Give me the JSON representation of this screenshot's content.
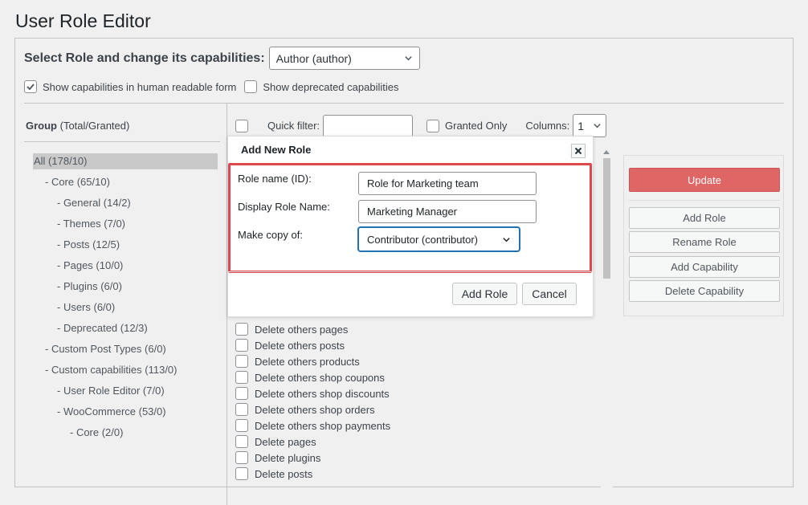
{
  "page": {
    "title": "User Role Editor"
  },
  "role_selector": {
    "label": "Select Role and change its capabilities:",
    "value": "Author (author)"
  },
  "options": {
    "human_readable": {
      "label": "Show capabilities in human readable form",
      "checked": true
    },
    "deprecated": {
      "label": "Show deprecated capabilities",
      "checked": false
    }
  },
  "group": {
    "heading": "Group",
    "heading_sub": "(Total/Granted)",
    "items": [
      "All (178/10)",
      "- Core (65/10)",
      "- General (14/2)",
      "- Themes (7/0)",
      "- Posts (12/5)",
      "- Pages (10/0)",
      "- Plugins (6/0)",
      "- Users (6/0)",
      "- Deprecated (12/3)",
      "- Custom Post Types (6/0)",
      "- Custom capabilities (113/0)",
      "- User Role Editor (7/0)",
      "- WooCommerce (53/0)",
      "- Core (2/0)"
    ]
  },
  "filter": {
    "quick_filter_label": "Quick filter:",
    "granted_only_label": "Granted Only",
    "columns_label": "Columns:",
    "columns_value": "1"
  },
  "capabilities": [
    "Delete others pages",
    "Delete others posts",
    "Delete others products",
    "Delete others shop coupons",
    "Delete others shop discounts",
    "Delete others shop orders",
    "Delete others shop payments",
    "Delete pages",
    "Delete plugins",
    "Delete posts"
  ],
  "actions": {
    "update": "Update",
    "add_role": "Add Role",
    "rename_role": "Rename Role",
    "add_capability": "Add Capability",
    "delete_capability": "Delete Capability"
  },
  "dialog": {
    "title": "Add New Role",
    "role_name_label": "Role name (ID):",
    "role_name_value": "Role for Marketing team",
    "display_name_label": "Display Role Name:",
    "display_name_value": "Marketing Manager",
    "copy_label": "Make copy of:",
    "copy_value": "Contributor (contributor)",
    "add_button": "Add Role",
    "cancel_button": "Cancel"
  },
  "colors": {
    "update_button": "#e06565",
    "highlight": "#e0474c",
    "focus": "#2271b1"
  }
}
